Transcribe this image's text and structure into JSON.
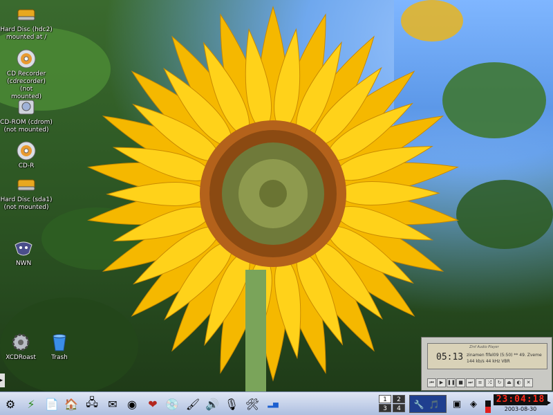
{
  "desktop": {
    "icons": [
      {
        "label": "Hard Disc (hdc2)\nmounted at /",
        "icon": "hard-disk-icon"
      },
      {
        "label": "CD Recorder\n(cdrecorder) (not\nmounted)",
        "icon": "cd-recorder-icon"
      },
      {
        "label": "CD-ROM (cdrom)\n(not mounted)",
        "icon": "cdrom-icon"
      },
      {
        "label": "CD-R",
        "icon": "cd-r-icon"
      },
      {
        "label": "Hard Disc (sda1)\n(not mounted)",
        "icon": "hard-disk-icon"
      },
      {
        "label": "NWN",
        "icon": "nwn-icon"
      },
      {
        "label": "XCDRoast",
        "icon": "xcdroast-icon"
      },
      {
        "label": "Trash",
        "icon": "trash-icon"
      }
    ]
  },
  "player": {
    "brand": "Zinf Audio Player",
    "time": "05:13",
    "title": "zinamen fifel09 (5:50)  **  49. Zveme",
    "bitrate": "144 kb/s",
    "samplerate": "44 kHz",
    "mode": "VBR"
  },
  "taskbar": {
    "pager": [
      "1",
      "2",
      "3",
      "4"
    ],
    "clock": "23:04:18",
    "date": "2003-08-30"
  },
  "colors": {
    "clock_fg": "#ff2a1a",
    "clock_bg": "#111111",
    "taskbar": "#c3cfe8"
  }
}
